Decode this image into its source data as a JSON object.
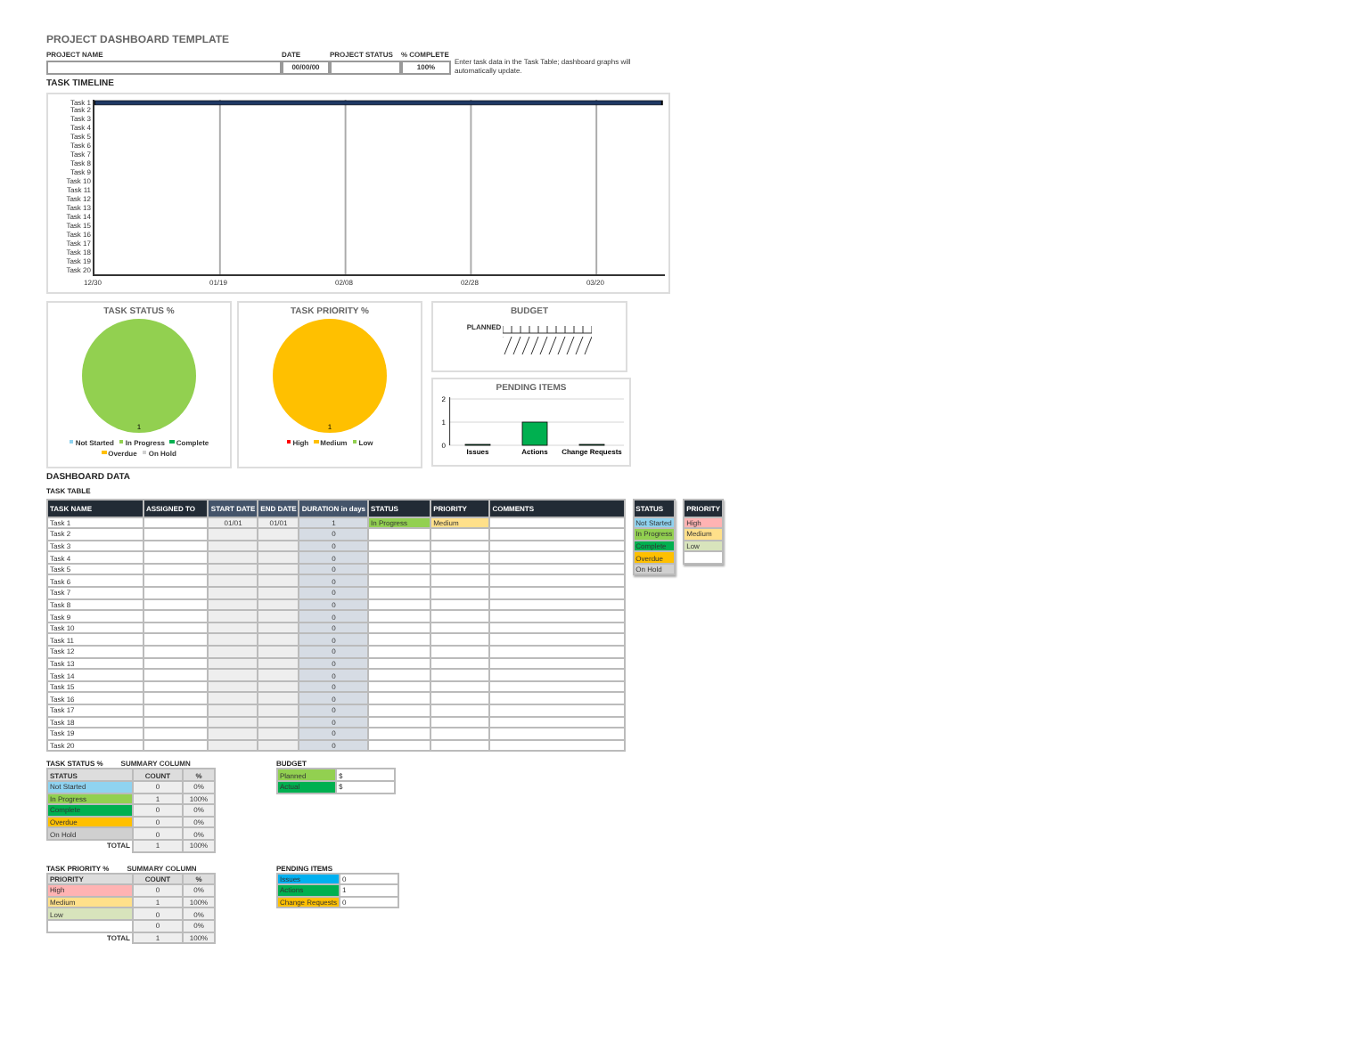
{
  "title": "PROJECT DASHBOARD TEMPLATE",
  "header": {
    "fields": [
      {
        "label": "PROJECT NAME"
      },
      {
        "label": "DATE",
        "value": "00/00/00"
      },
      {
        "label": "PROJECT STATUS"
      },
      {
        "label": "% COMPLETE",
        "value": "100%"
      }
    ],
    "note": "Enter task data in the Task Table; dashboard graphs will automatically update."
  },
  "timeline": {
    "heading": "TASK TIMELINE",
    "tasks": [
      "Task 1",
      "Task 2",
      "Task 3",
      "Task 4",
      "Task 5",
      "Task 6",
      "Task 7",
      "Task 8",
      "Task 9",
      "Task 10",
      "Task 11",
      "Task 12",
      "Task 13",
      "Task 14",
      "Task 15",
      "Task 16",
      "Task 17",
      "Task 18",
      "Task 19",
      "Task 20"
    ],
    "dates": [
      "12/30",
      "01/19",
      "02/08",
      "02/28",
      "03/20"
    ]
  },
  "status_chart": {
    "chart_data": {
      "type": "pie",
      "title": "TASK STATUS %",
      "categories": [
        "Not Started",
        "In Progress",
        "Complete",
        "Overdue",
        "On Hold"
      ],
      "values": [
        0,
        1,
        0,
        0,
        0
      ],
      "colors": [
        "#8fd3f0",
        "#92d050",
        "#00b050",
        "#ffc000",
        "#d0d0d0"
      ]
    },
    "slice_label": "1"
  },
  "priority_chart": {
    "chart_data": {
      "type": "pie",
      "title": "TASK PRIORITY %",
      "categories": [
        "High",
        "Medium",
        "Low"
      ],
      "values": [
        0,
        1,
        0
      ],
      "colors": [
        "#ff0000",
        "#ffc000",
        "#92d050"
      ]
    },
    "slice_label": "1"
  },
  "budget_chart": {
    "title": "BUDGET",
    "series_label": "PLANNED"
  },
  "pending_chart": {
    "chart_data": {
      "type": "bar",
      "title": "PENDING ITEMS",
      "categories": [
        "Issues",
        "Actions",
        "Change Requests"
      ],
      "values": [
        0,
        1,
        0
      ],
      "yticks": [
        0,
        1,
        2
      ],
      "ylim": [
        0,
        2
      ]
    }
  },
  "dashboard_heading": "DASHBOARD DATA",
  "task_table": {
    "heading": "TASK TABLE",
    "columns": [
      "TASK NAME",
      "ASSIGNED TO",
      "START DATE",
      "END DATE",
      "DURATION in days",
      "STATUS",
      "PRIORITY",
      "COMMENTS"
    ],
    "rows": [
      [
        "Task 1",
        "",
        "01/01",
        "01/01",
        "1",
        "In Progress",
        "Medium",
        ""
      ],
      [
        "Task 2",
        "",
        "",
        "",
        "0",
        "",
        "",
        ""
      ],
      [
        "Task 3",
        "",
        "",
        "",
        "0",
        "",
        "",
        ""
      ],
      [
        "Task 4",
        "",
        "",
        "",
        "0",
        "",
        "",
        ""
      ],
      [
        "Task 5",
        "",
        "",
        "",
        "0",
        "",
        "",
        ""
      ],
      [
        "Task 6",
        "",
        "",
        "",
        "0",
        "",
        "",
        ""
      ],
      [
        "Task 7",
        "",
        "",
        "",
        "0",
        "",
        "",
        ""
      ],
      [
        "Task 8",
        "",
        "",
        "",
        "0",
        "",
        "",
        ""
      ],
      [
        "Task 9",
        "",
        "",
        "",
        "0",
        "",
        "",
        ""
      ],
      [
        "Task 10",
        "",
        "",
        "",
        "0",
        "",
        "",
        ""
      ],
      [
        "Task 11",
        "",
        "",
        "",
        "0",
        "",
        "",
        ""
      ],
      [
        "Task 12",
        "",
        "",
        "",
        "0",
        "",
        "",
        ""
      ],
      [
        "Task 13",
        "",
        "",
        "",
        "0",
        "",
        "",
        ""
      ],
      [
        "Task 14",
        "",
        "",
        "",
        "0",
        "",
        "",
        ""
      ],
      [
        "Task 15",
        "",
        "",
        "",
        "0",
        "",
        "",
        ""
      ],
      [
        "Task 16",
        "",
        "",
        "",
        "0",
        "",
        "",
        ""
      ],
      [
        "Task 17",
        "",
        "",
        "",
        "0",
        "",
        "",
        ""
      ],
      [
        "Task 18",
        "",
        "",
        "",
        "0",
        "",
        "",
        ""
      ],
      [
        "Task 19",
        "",
        "",
        "",
        "0",
        "",
        "",
        ""
      ],
      [
        "Task 20",
        "",
        "",
        "",
        "0",
        "",
        "",
        ""
      ]
    ]
  },
  "status_legend": {
    "heading": "STATUS",
    "items": [
      {
        "label": "Not Started",
        "color": "#8fd3f0"
      },
      {
        "label": "In Progress",
        "color": "#92d050"
      },
      {
        "label": "Complete",
        "color": "#00b050"
      },
      {
        "label": "Overdue",
        "color": "#ffc000"
      },
      {
        "label": "On Hold",
        "color": "#d0d0d0"
      }
    ]
  },
  "priority_legend": {
    "heading": "PRIORITY",
    "items": [
      {
        "label": "High",
        "color": "#ffb3b3"
      },
      {
        "label": "Medium",
        "color": "#ffe08a"
      },
      {
        "label": "Low",
        "color": "#d8e4bc"
      },
      {
        "color": "#ffffff"
      }
    ]
  },
  "status_summary": {
    "heading": "TASK STATUS %",
    "note": "SUMMARY COLUMN",
    "columns": [
      "STATUS",
      "COUNT",
      "%"
    ],
    "rows": [
      {
        "label": "Not Started",
        "color": "#8fd3f0",
        "count": "0",
        "pct": "0%"
      },
      {
        "label": "In Progress",
        "color": "#92d050",
        "count": "1",
        "pct": "100%"
      },
      {
        "label": "Complete",
        "color": "#00b050",
        "count": "0",
        "pct": "0%"
      },
      {
        "label": "Overdue",
        "color": "#ffc000",
        "count": "0",
        "pct": "0%"
      },
      {
        "label": "On Hold",
        "color": "#d0d0d0",
        "count": "0",
        "pct": "0%"
      }
    ],
    "total": {
      "label": "TOTAL",
      "count": "1",
      "pct": "100%"
    }
  },
  "priority_summary": {
    "heading": "TASK PRIORITY %",
    "note": "SUMMARY COLUMN",
    "columns": [
      "PRIORITY",
      "COUNT",
      "%"
    ],
    "rows": [
      {
        "label": "High",
        "color": "#ffb3b3",
        "count": "0",
        "pct": "0%"
      },
      {
        "label": "Medium",
        "color": "#ffe08a",
        "count": "1",
        "pct": "100%"
      },
      {
        "label": "Low",
        "color": "#d8e4bc",
        "count": "0",
        "pct": "0%"
      },
      {
        "color": "#ffffff",
        "count": "0",
        "pct": "0%"
      }
    ],
    "total": {
      "label": "TOTAL",
      "count": "1",
      "pct": "100%"
    }
  },
  "budget_summary": {
    "heading": "BUDGET",
    "rows": [
      {
        "label": "Planned",
        "color": "#92d050",
        "value": "$"
      },
      {
        "label": "Actual",
        "color": "#00b050",
        "value": "$"
      }
    ]
  },
  "pending_summary": {
    "heading": "PENDING ITEMS",
    "rows": [
      {
        "label": "Issues",
        "color": "#00b0f0",
        "value": "0"
      },
      {
        "label": "Actions",
        "color": "#00b050",
        "value": "1"
      },
      {
        "label": "Change Requests",
        "color": "#ffc000",
        "value": "0"
      }
    ]
  }
}
